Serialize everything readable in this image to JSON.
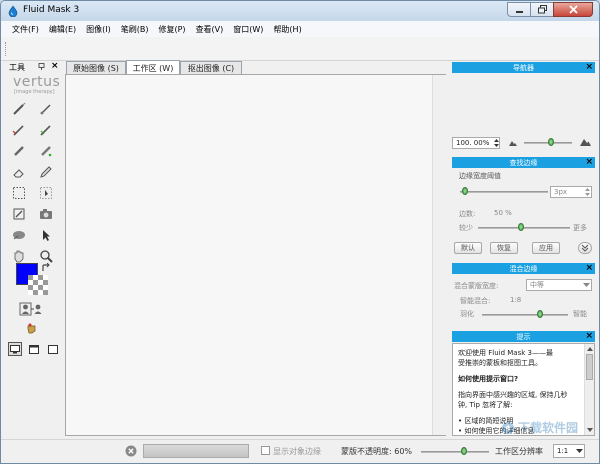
{
  "window": {
    "title": "Fluid Mask 3",
    "controls": [
      "minimize",
      "restore",
      "close"
    ]
  },
  "menu": [
    "文件(F)",
    "编辑(E)",
    "图像(I)",
    "笔刷(B)",
    "修复(P)",
    "查看(V)",
    "窗口(W)",
    "帮助(H)"
  ],
  "tools_panel": {
    "title": "工具",
    "logo": "vertus",
    "logo_sub": "[image therapy]",
    "foreground_color": "#0000ff"
  },
  "tabs": [
    {
      "label": "原始图像 (S)",
      "active": false
    },
    {
      "label": "工作区 (W)",
      "active": true
    },
    {
      "label": "抠出图像 (C)",
      "active": false
    }
  ],
  "navigator": {
    "title": "导航器",
    "zoom": "100. 00%"
  },
  "find_edges": {
    "title": "查找边缘",
    "threshold_label": "边缘宽度阈值",
    "threshold_value": "3px",
    "edge_label": "边数:",
    "edge_value": "50 %",
    "less": "较少",
    "more": "更多",
    "buttons": [
      "默认",
      "恢复",
      "应用"
    ]
  },
  "blend_edges": {
    "title": "混合边缘",
    "width_label": "混合蒙版宽度:",
    "width_value": "中等",
    "smart_label": "智能混合:",
    "smart_value": "1:8",
    "feather": "羽化",
    "smart": "智能"
  },
  "hints": {
    "title": "提示",
    "lines": [
      {
        "text": "欢迎使用 Fluid Mask 3——最",
        "bold": false
      },
      {
        "text": "受推崇的蒙板和抠图工具。",
        "bold": false
      },
      {
        "text": "如何使用提示窗口?",
        "bold": true
      },
      {
        "text": "指向界面中感兴趣的区域, 保持几秒",
        "bold": false
      },
      {
        "text": "钟, Tip 忽将了解:",
        "bold": false
      },
      {
        "text": "• 区域的简短说明",
        "bold": false
      },
      {
        "text": "• 如何使用它的详细信息",
        "bold": false
      }
    ]
  },
  "status": {
    "show_edges": "显示对象边缘",
    "mask_opacity": "蒙版不透明度: 60%",
    "resolution_label": "工作区分辨率",
    "resolution_value": "1:1"
  },
  "watermark": "下载软件园"
}
